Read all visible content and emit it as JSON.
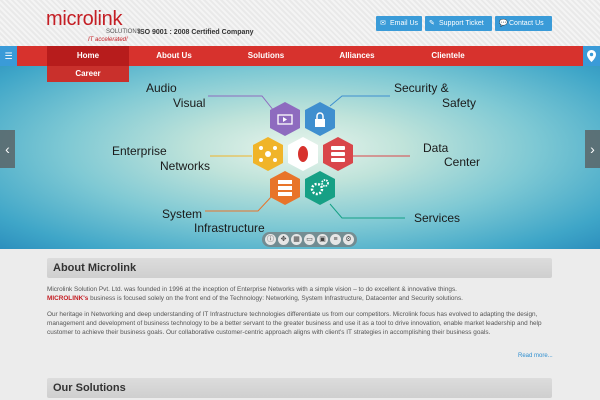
{
  "header": {
    "logo_word": "microlink",
    "logo_sub": "SOLUTIONS",
    "logo_tagline": "IT accelerated!",
    "certification": "ISO 9001 : 2008 Certified Company",
    "buttons": [
      {
        "label": "Email Us",
        "icon": "envelope-icon"
      },
      {
        "label": "Support Ticket",
        "icon": "ticket-icon"
      },
      {
        "label": "Contact Us",
        "icon": "chat-icon"
      }
    ]
  },
  "nav": {
    "items": [
      "Home",
      "About Us",
      "Solutions",
      "Alliances",
      "Clientele"
    ],
    "dropdown_item": "Career",
    "menu_icon": "menu-toggle-icon",
    "location_icon": "map-pin-icon"
  },
  "banner": {
    "labels": {
      "audio": "Audio",
      "visual": "Visual",
      "security": "Security &",
      "safety": "Safety",
      "enterprise": "Enterprise",
      "networks": "Networks",
      "data": "Data",
      "center": "Center",
      "system": "System",
      "infrastructure": "Infrastructure",
      "services": "Services"
    },
    "prev_icon": "chevron-left-icon",
    "next_icon": "chevron-right-icon",
    "controls": [
      "info-icon",
      "move-icon",
      "grid-icon",
      "slides-icon",
      "thumbnail-icon",
      "list-icon",
      "gear-icon"
    ]
  },
  "about": {
    "title": "About Microlink",
    "p1": "Microlink Solution Pvt. Ltd. was founded in 1996 at the inception of Enterprise Networks with a simple vision – to do excellent & innovative things.",
    "p2_brand": "MICROLINK's",
    "p2_rest": " business is focused solely on the front end of the Technology: Networking, System Infrastructure, Datacenter and Security solutions.",
    "p3": "Our heritage in Networking and deep understanding of IT Infrastructure technologies differentiate us from our competitors. Microlink focus has evolved to adapting the design, management and development of business technology to be a better servant to the greater business and use it as a tool to drive innovation, enable market leadership and help customer to achieve their business goals. Our collaborative customer-centric approach aligns with client's IT strategies in accomplishing their business goals.",
    "read_more": "Read more..."
  },
  "solutions": {
    "title": "Our Solutions"
  },
  "colors": {
    "brand_red": "#d7322d",
    "accent_blue": "#3a9bd8",
    "hex_purple": "#8e6bbf",
    "hex_blue": "#3f8fcf",
    "hex_red": "#d9464a",
    "hex_teal": "#16a085",
    "hex_orange": "#e8742a",
    "hex_yellow": "#f0b429"
  }
}
